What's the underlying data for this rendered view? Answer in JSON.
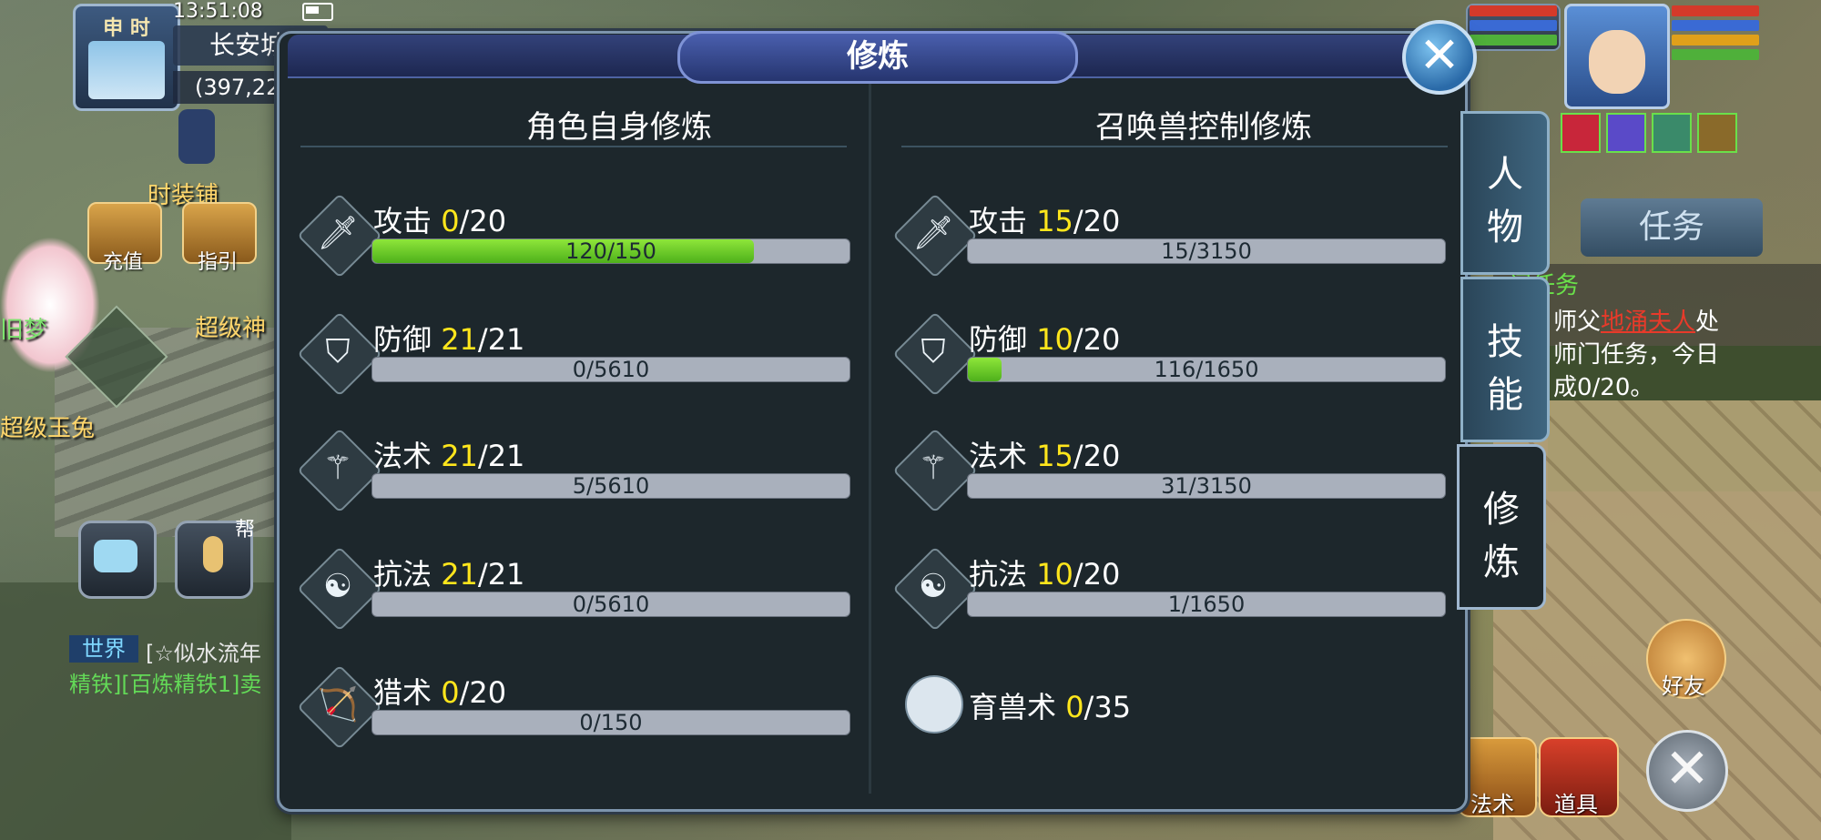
{
  "hud": {
    "time_period": "申 时",
    "clock": "13:51:08",
    "location": "长安城",
    "coords": "(397,22",
    "npc_shop": "时装铺",
    "npc_left_name": "旧梦",
    "npc_rabbit": "超级玉兔",
    "npc_super": "超级神",
    "icon_recharge": "充值",
    "icon_guide": "指引",
    "voice_tag": "帮",
    "chat_channel": "世界",
    "chat_line1": "[☆似水流年",
    "chat_line2": "精铁][百炼精铁1]卖",
    "task_tab": "任务",
    "task_header": "门任务",
    "task_line1_pre": "师父",
    "task_line1_npc": "地涌夫人",
    "task_line1_post": "处",
    "task_line2": "师门任务，今日",
    "task_line3": "成0/20。",
    "friends_label": "好友",
    "magic_label": "法术",
    "items_label": "道具"
  },
  "panel": {
    "title": "修炼",
    "close_glyph": "✕",
    "left_title": "角色自身修炼",
    "right_title": "召唤兽控制修炼",
    "left_rows": [
      {
        "name": "攻击",
        "level": "0",
        "max": "/20",
        "progress": "120/150",
        "fill": 0.8
      },
      {
        "name": "防御",
        "level": "21",
        "max": "/21",
        "progress": "0/5610",
        "fill": 0
      },
      {
        "name": "法术",
        "level": "21",
        "max": "/21",
        "progress": "5/5610",
        "fill": 0
      },
      {
        "name": "抗法",
        "level": "21",
        "max": "/21",
        "progress": "0/5610",
        "fill": 0
      },
      {
        "name": "猎术",
        "level": "0",
        "max": "/20",
        "progress": "0/150",
        "fill": 0
      }
    ],
    "right_rows": [
      {
        "name": "攻击",
        "level": "15",
        "max": "/20",
        "progress": "15/3150",
        "fill": 0
      },
      {
        "name": "防御",
        "level": "10",
        "max": "/20",
        "progress": "116/1650",
        "fill": 0.07
      },
      {
        "name": "法术",
        "level": "15",
        "max": "/20",
        "progress": "31/3150",
        "fill": 0
      },
      {
        "name": "抗法",
        "level": "10",
        "max": "/20",
        "progress": "1/1650",
        "fill": 0
      }
    ],
    "pet_skill": {
      "name": "育兽术",
      "level": "0",
      "max": "/35"
    },
    "tabs": [
      {
        "line1": "人",
        "line2": "物"
      },
      {
        "line1": "技",
        "line2": "能"
      },
      {
        "line1": "修",
        "line2": "炼"
      }
    ]
  }
}
